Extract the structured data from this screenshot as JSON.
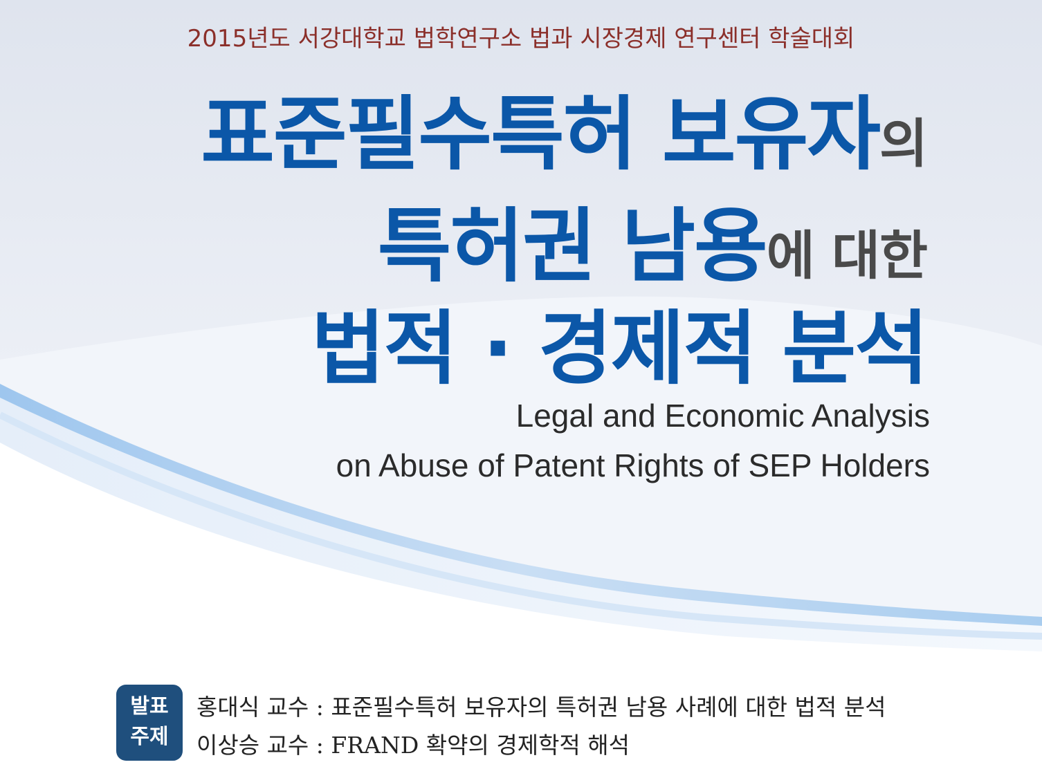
{
  "header": {
    "conference": "2015년도 서강대학교 법학연구소 법과 시장경제 연구센터 학술대회"
  },
  "title": {
    "line1_main": "표준필수특허 보유자",
    "line1_suffix": "의",
    "line2_main": "특허권 남용",
    "line2_suffix": "에 대한",
    "line3": "법적 · 경제적 분석"
  },
  "english_title": {
    "line1": "Legal and Economic Analysis",
    "line2": "on Abuse of Patent Rights of SEP Holders"
  },
  "presentations": {
    "badge_line1": "발표",
    "badge_line2": "주제",
    "items": [
      "홍대식 교수 : 표준필수특허 보유자의 특허권 남용 사례에 대한 법적 분석",
      "이상승 교수 : FRAND 확약의 경제학적 해석"
    ]
  },
  "colors": {
    "header": "#8b2f2a",
    "title_blue": "#0b57a8",
    "title_gray": "#4a4a4a",
    "badge": "#1f4f7d"
  }
}
